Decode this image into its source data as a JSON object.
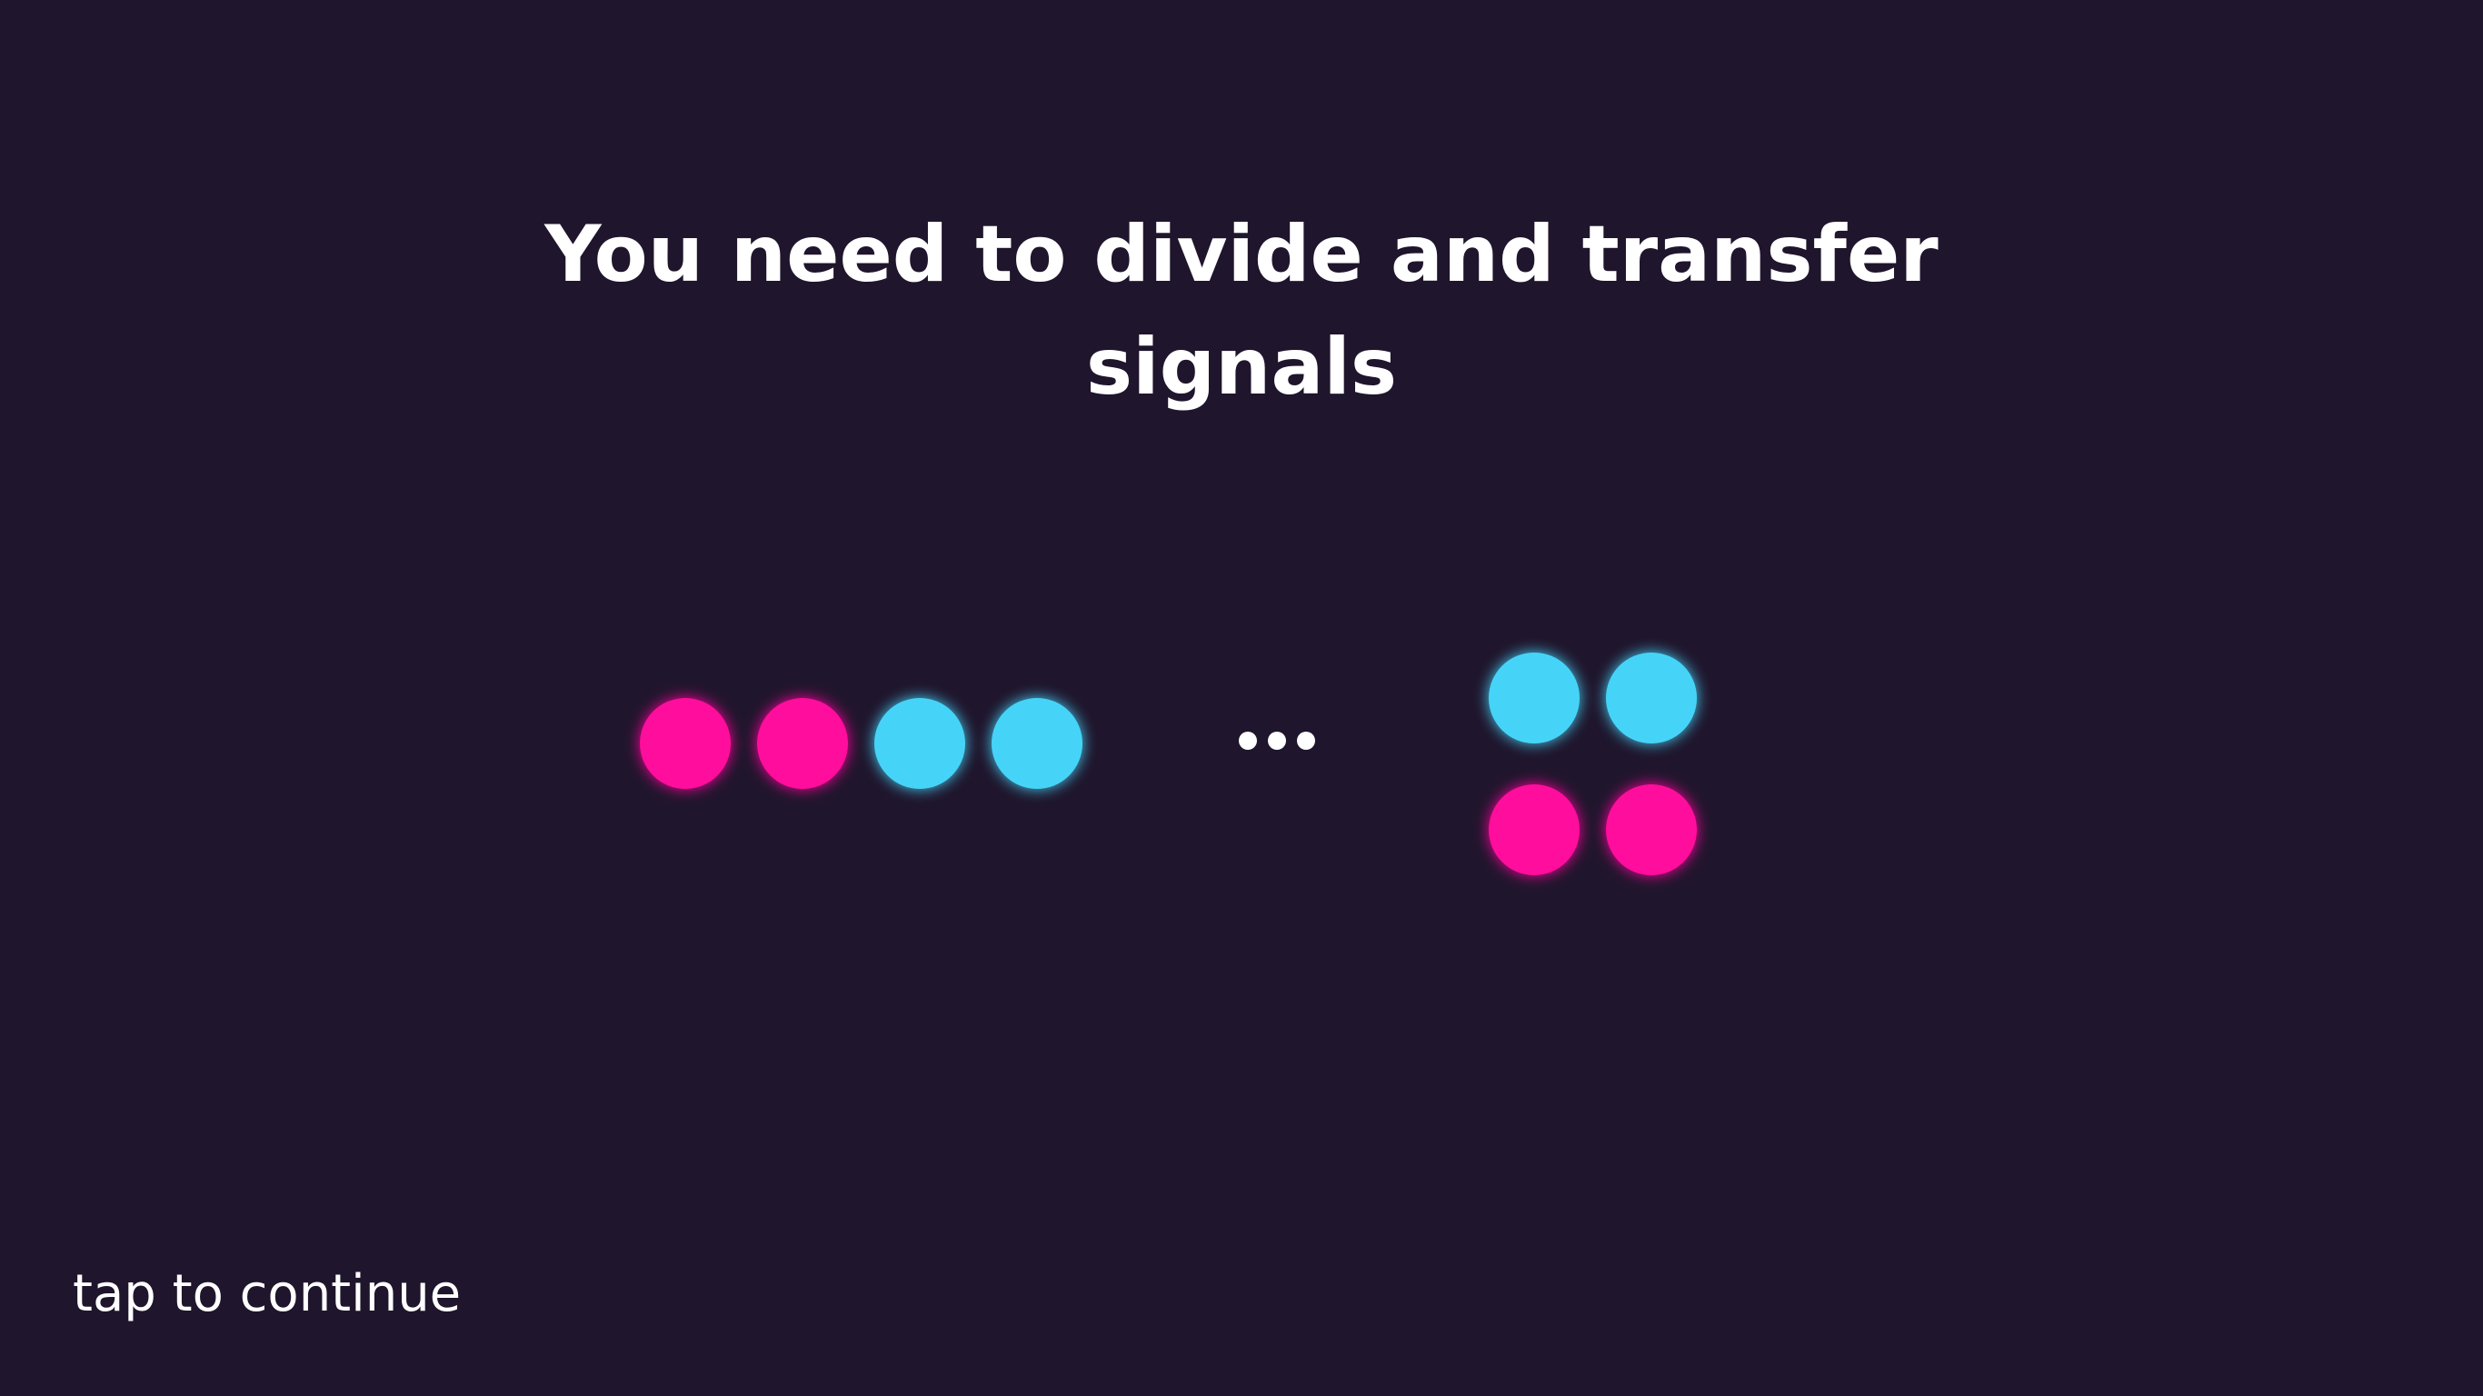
{
  "screen": {
    "title": "You need to divide and transfer signals",
    "hint": "tap to continue",
    "ellipsis_icon": "ellipsis-icon"
  },
  "colors": {
    "background": "#1f152c",
    "wire": "#ffffff",
    "magenta": "#ff0a9c",
    "cyan": "#45d4f8"
  },
  "illustration": {
    "before": {
      "signals": [
        "magenta",
        "magenta",
        "cyan",
        "cyan"
      ]
    },
    "after": [
      {
        "signals": [
          "cyan",
          "cyan"
        ]
      },
      {
        "signals": [
          "magenta",
          "magenta"
        ]
      }
    ]
  }
}
